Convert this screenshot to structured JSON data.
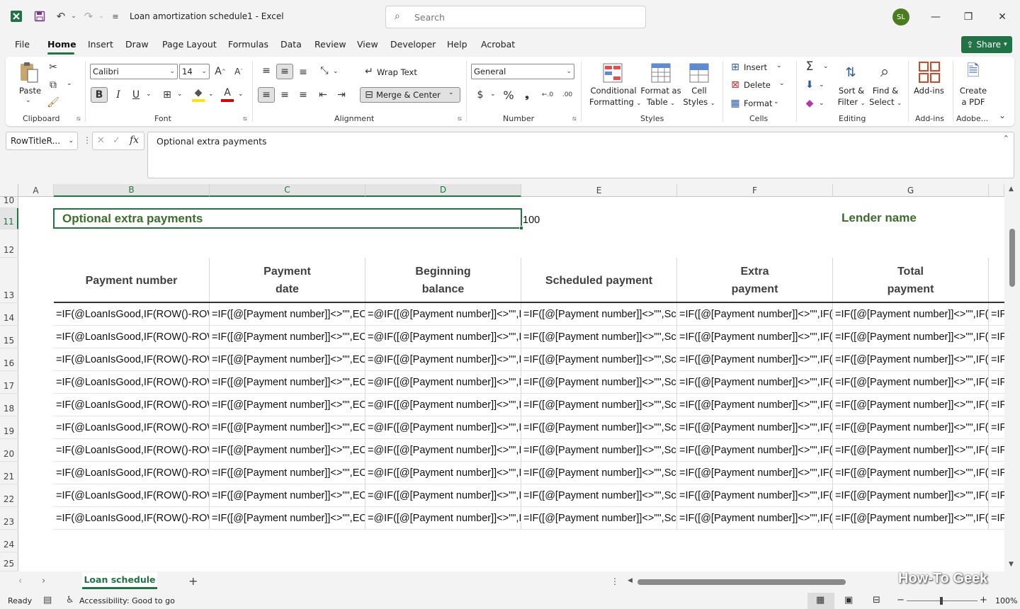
{
  "titlebar": {
    "doc_title": "Loan amortization schedule1  -  Excel",
    "search_placeholder": "Search",
    "avatar_initials": "SL"
  },
  "menu": {
    "tabs": [
      "File",
      "Home",
      "Insert",
      "Draw",
      "Page Layout",
      "Formulas",
      "Data",
      "Review",
      "View",
      "Developer",
      "Help",
      "Acrobat"
    ],
    "active": "Home",
    "share_label": "Share"
  },
  "ribbon": {
    "clipboard": {
      "label": "Clipboard",
      "paste": "Paste"
    },
    "font": {
      "label": "Font",
      "name": "Calibri",
      "size": "14"
    },
    "alignment": {
      "label": "Alignment",
      "wrap_text": "Wrap Text",
      "merge_center": "Merge & Center"
    },
    "number": {
      "label": "Number",
      "format": "General"
    },
    "styles": {
      "label": "Styles",
      "conditional_1": "Conditional",
      "conditional_2": "Formatting",
      "format_table_1": "Format as",
      "format_table_2": "Table",
      "cell_styles_1": "Cell",
      "cell_styles_2": "Styles"
    },
    "cells": {
      "label": "Cells",
      "insert": "Insert",
      "delete": "Delete",
      "format": "Format"
    },
    "editing": {
      "label": "Editing",
      "sort_1": "Sort &",
      "sort_2": "Filter",
      "find_1": "Find &",
      "find_2": "Select"
    },
    "addins": {
      "label": "Add-ins",
      "addins_btn": "Add-ins"
    },
    "adobe": {
      "label": "Adobe...",
      "create_1": "Create",
      "create_2": "a PDF"
    }
  },
  "formula_bar": {
    "name_box": "RowTitleR...",
    "fx": "fx",
    "content": "Optional extra payments"
  },
  "grid": {
    "columns": [
      "A",
      "B",
      "C",
      "D",
      "E",
      "F",
      "G"
    ],
    "rows": [
      "10",
      "11",
      "12",
      "13",
      "14",
      "15",
      "16",
      "17",
      "18",
      "19",
      "20",
      "21",
      "22",
      "23",
      "24",
      "25"
    ],
    "b11": "Optional extra payments",
    "e11": "100",
    "g11": "Lender name",
    "headers": {
      "b": [
        "Payment number"
      ],
      "c": [
        "Payment",
        "date"
      ],
      "d": [
        "Beginning",
        "balance"
      ],
      "e": [
        "Scheduled payment"
      ],
      "f": [
        "Extra",
        "payment"
      ],
      "g": [
        "Total",
        "payment"
      ]
    },
    "formulas": {
      "b": "=IF(@LoanIsGood,IF(ROW()-ROW",
      "c": "=IF([@[Payment number]]<>\"\",EO",
      "d": "=@IF([@[Payment number]]<>\"\",I",
      "e": "=IF([@[Payment number]]<>\"\",Sch",
      "f": "=IF([@[Payment number]]<>\"\",IF(",
      "g": "=IF([@[Payment number]]<>\"\",IF(",
      "h": "=IF"
    }
  },
  "sheet_tabs": {
    "active": "Loan schedule"
  },
  "statusbar": {
    "ready": "Ready",
    "accessibility": "Accessibility: Good to go",
    "zoom": "100%"
  },
  "watermark": "How-To Geek",
  "colors": {
    "excel_green": "#217346",
    "header_text": "#404040",
    "accent_title": "#3a6e2a"
  }
}
